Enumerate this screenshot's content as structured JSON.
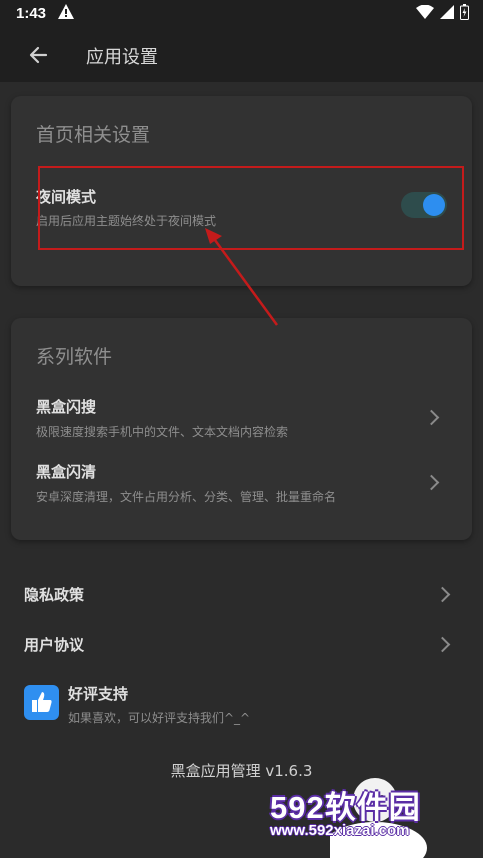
{
  "status_bar": {
    "time": "1:43"
  },
  "toolbar": {
    "title": "应用设置"
  },
  "home_card": {
    "title": "首页相关设置",
    "night_mode": {
      "title": "夜间模式",
      "desc": "启用后应用主题始终处于夜间模式",
      "enabled": true
    }
  },
  "series_card": {
    "title": "系列软件",
    "items": [
      {
        "title": "黑盒闪搜",
        "desc": "极限速度搜索手机中的文件、文本文档内容检索"
      },
      {
        "title": "黑盒闪清",
        "desc": "安卓深度清理，文件占用分析、分类、管理、批量重命名"
      }
    ]
  },
  "links": {
    "privacy": "隐私政策",
    "agreement": "用户协议"
  },
  "rating": {
    "title": "好评支持",
    "desc": "如果喜欢，可以好评支持我们^_^"
  },
  "version": "黑盒应用管理 v1.6.3",
  "watermark": {
    "brand": "592软件园",
    "url": "www.592xiazai.com"
  },
  "colors": {
    "accent": "#2d8ef0",
    "annotation": "#c41b1b",
    "background": "#2b2b2b",
    "card": "#323232"
  }
}
